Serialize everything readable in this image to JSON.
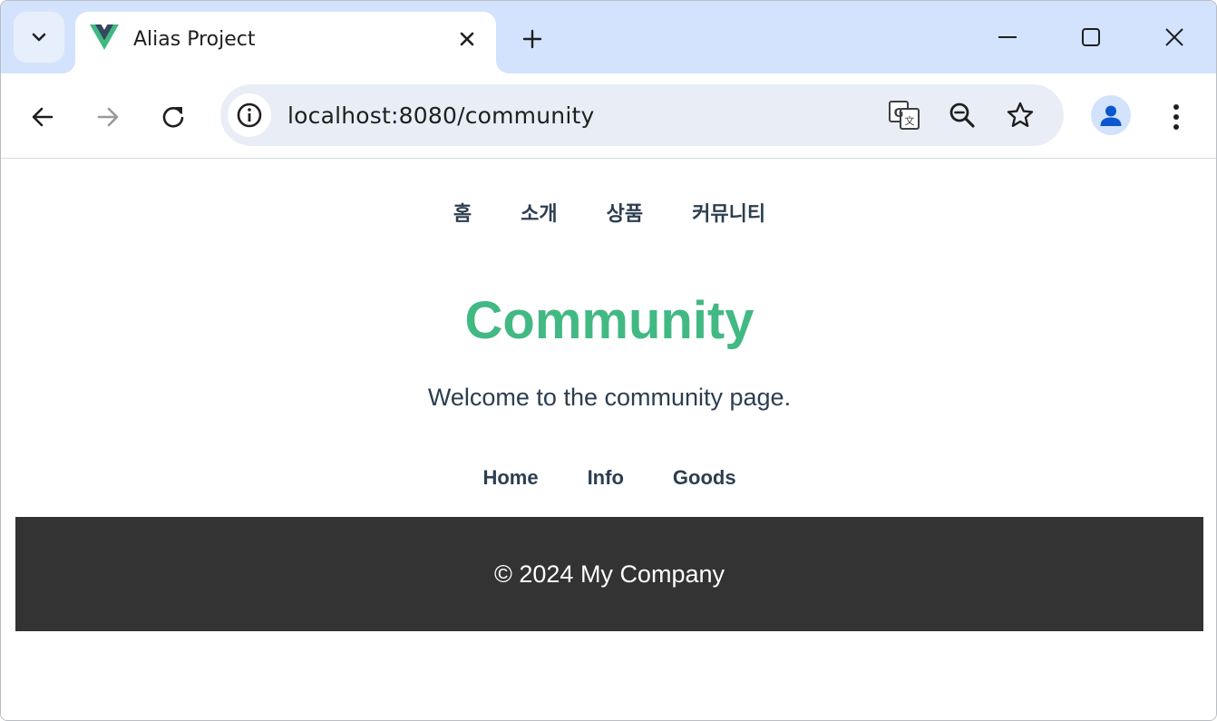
{
  "browser": {
    "tab": {
      "title": "Alias Project",
      "favicon": "vue-logo-icon"
    },
    "address_bar": {
      "url": "localhost:8080/community"
    },
    "icons": {
      "tab_search": "chevron-down-icon",
      "close_tab": "close-icon",
      "new_tab": "plus-icon",
      "minimize": "minimize-icon",
      "maximize": "maximize-icon",
      "close_window": "close-icon",
      "back": "arrow-left-icon",
      "forward": "arrow-right-icon",
      "reload": "reload-icon",
      "site_info": "info-icon",
      "translate": "translate-icon",
      "zoom": "zoom-out-icon",
      "bookmark": "star-icon",
      "profile": "person-icon",
      "menu": "more-vertical-icon"
    }
  },
  "page": {
    "nav_kr": [
      {
        "label": "홈"
      },
      {
        "label": "소개"
      },
      {
        "label": "상품"
      },
      {
        "label": "커뮤니티"
      }
    ],
    "heading": "Community",
    "welcome": "Welcome to the community page.",
    "nav_en": [
      {
        "label": "Home"
      },
      {
        "label": "Info"
      },
      {
        "label": "Goods"
      }
    ],
    "footer": "© 2024 My Company"
  },
  "colors": {
    "accent": "#42b983",
    "text": "#2c3e50",
    "footer_bg": "#333333",
    "tabstrip_bg": "#d3e3fd",
    "omnibox_bg": "#e9eef6",
    "profile_icon": "#0b57d0"
  }
}
